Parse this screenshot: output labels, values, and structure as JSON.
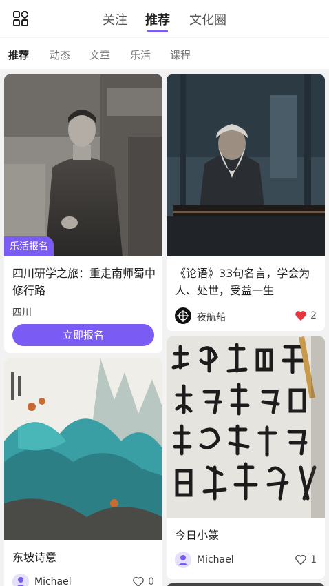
{
  "top_nav": {
    "tabs": [
      "关注",
      "推荐",
      "文化圈"
    ],
    "active_tab": "推荐"
  },
  "sub_nav": {
    "tabs": [
      "推荐",
      "动态",
      "文章",
      "乐活",
      "课程"
    ],
    "active_tab": "推荐"
  },
  "feed": {
    "card1": {
      "badge": "乐活报名",
      "title": "四川研学之旅：重走南师蜀中修行路",
      "location": "四川",
      "button_label": "立即报名"
    },
    "card2": {
      "title": "《论语》33句名言，学会为人、处世，受益一生",
      "author": "夜航船",
      "likes": "2",
      "liked": true
    },
    "card3": {
      "title": "东坡诗意",
      "author": "Michael",
      "likes": "0",
      "liked": false
    },
    "card4": {
      "title": "今日小篆",
      "author": "Michael",
      "likes": "1",
      "liked": false
    }
  },
  "colors": {
    "accent": "#7a5cf5",
    "like_red": "#e8363f"
  },
  "icons": [
    "grid-menu-icon",
    "heart-icon",
    "user-avatar-icon",
    "ship-logo-icon"
  ]
}
